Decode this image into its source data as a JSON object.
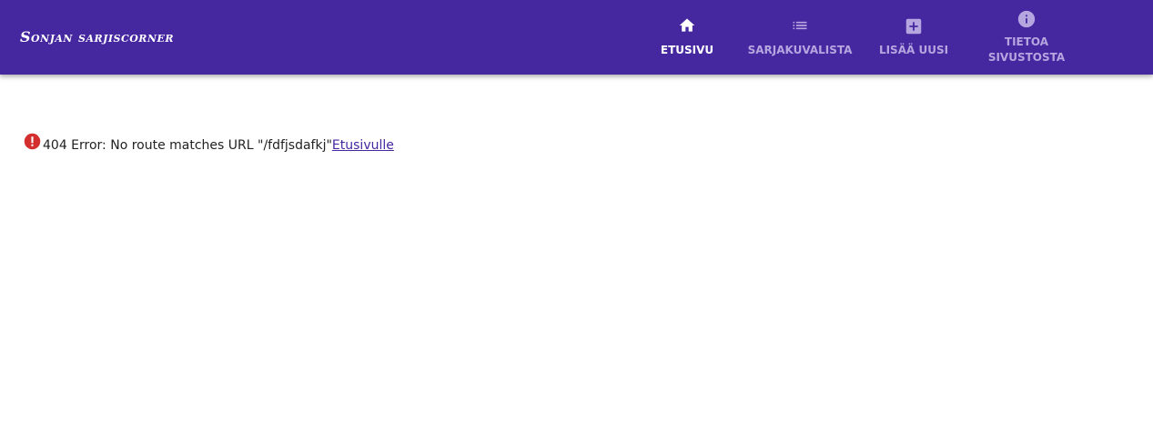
{
  "app": {
    "title": "Sonjan sarjiscorner",
    "brand_color": "#4527a0"
  },
  "nav": {
    "items": [
      {
        "label": "ETUSIVU",
        "icon": "home-icon",
        "active": true
      },
      {
        "label": "SARJAKUVALISTA",
        "icon": "list-icon",
        "active": false
      },
      {
        "label": "LISÄÄ UUSI",
        "icon": "add-box-icon",
        "active": false
      },
      {
        "label": "TIETOA\nSIVUSTOSTA",
        "icon": "info-icon",
        "active": false
      }
    ],
    "active_color": "#ffffff",
    "inactive_color": "#b6a6e0"
  },
  "error": {
    "icon": "error-icon",
    "icon_color": "#d32f2f",
    "message": "404 Error: No route matches URL \"/fdfjsdafkj\"",
    "link_label": "Etusivulle"
  }
}
